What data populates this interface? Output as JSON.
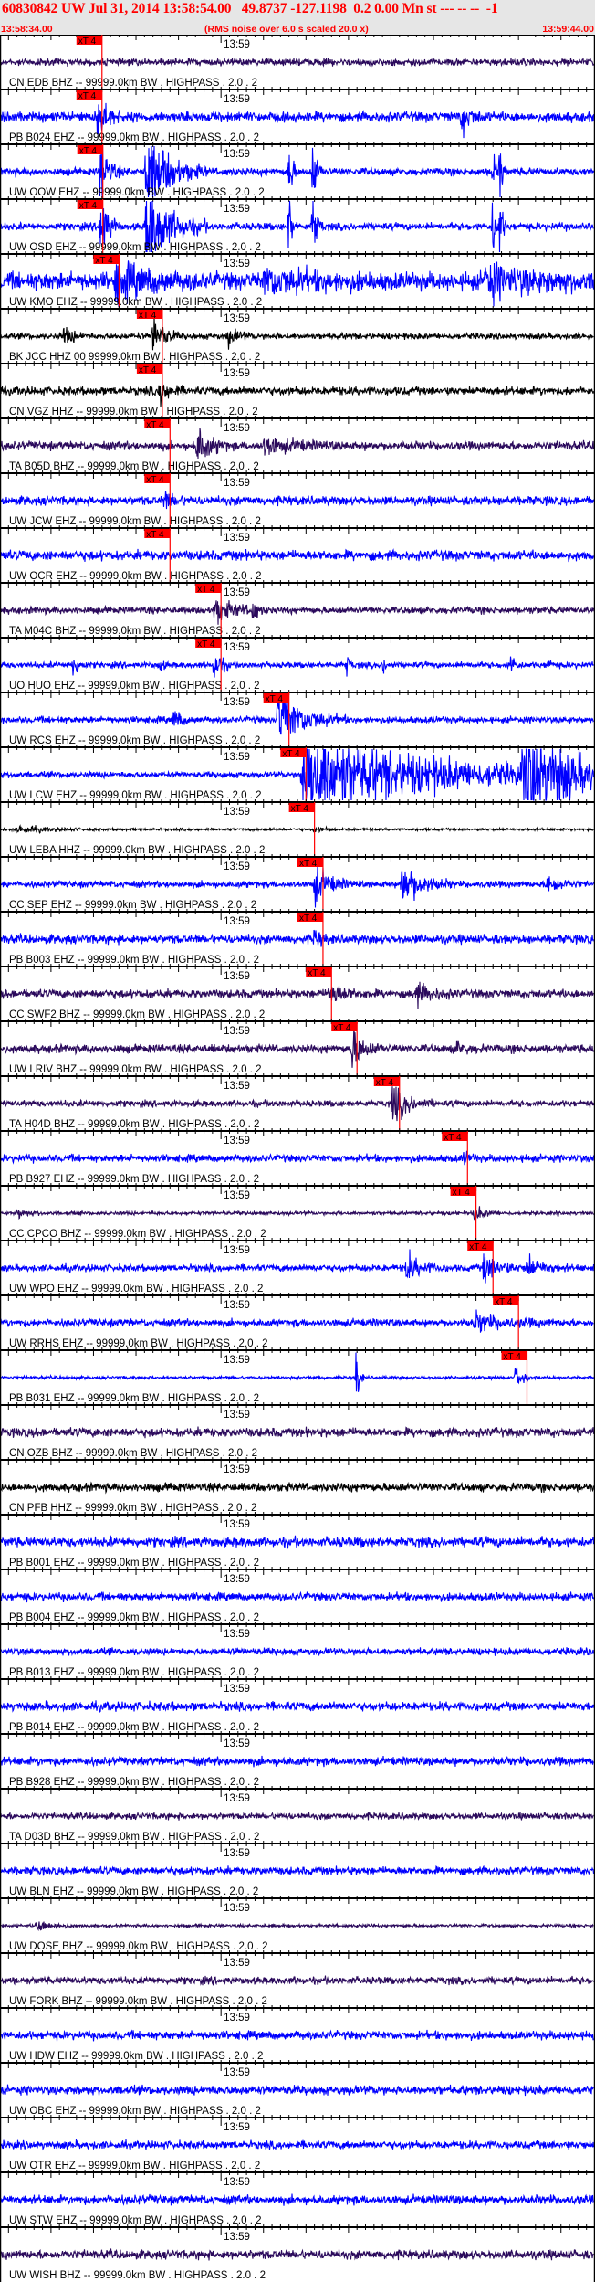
{
  "header": {
    "title": "60830842 UW Jul 31, 2014 13:58:54.00   49.8737 -127.1198  0.2 0.00 Mn st --- -- --  -1",
    "start_time": "13:58:34.00",
    "end_time": "13:59:44.00",
    "note": "(RMS noise over 6.0 s scaled 20.0 x)"
  },
  "time_axis": {
    "minute_label": "13:59",
    "minute_time": "13:59:00",
    "major_tick_s": 5,
    "minor_tick_s": 1
  },
  "pick_label": "xT 4",
  "colors": {
    "pick": "#ff0000",
    "header_text": "#ff0000",
    "header_bg": "#e6e6e6"
  },
  "traces": [
    {
      "label": "CN EDB BHZ -- 99999.0km BW . HIGHPASS . 2.0 . 2",
      "color": "#2b0a5c",
      "pick": "13:58:46.0",
      "noise": 0.14,
      "bursts": []
    },
    {
      "label": "PB B024 EHZ -- 99999.0km BW . HIGHPASS . 2.0 . 2",
      "color": "#0000ff",
      "pick": "13:58:46.0",
      "noise": 0.2,
      "bursts": [
        [
          "13:58:45.4",
          0.9,
          2
        ],
        [
          "13:59:28.3",
          0.5,
          2
        ]
      ]
    },
    {
      "label": "UW OOW EHZ -- 99999.0km BW . HIGHPASS . 2.0 . 2",
      "color": "#0000ff",
      "pick": "13:58:46.1",
      "noise": 0.15,
      "bursts": [
        [
          "13:58:45.8",
          1.6,
          1.5
        ],
        [
          "13:58:51.2",
          1.8,
          4.5
        ],
        [
          "13:59:08.0",
          1.5,
          0.6
        ],
        [
          "13:59:10.8",
          1.5,
          0.8
        ],
        [
          "13:59:32.0",
          1.5,
          0.5
        ],
        [
          "13:59:32.8",
          1.5,
          0.5
        ]
      ]
    },
    {
      "label": "UW OSD EHZ -- 99999.0km BW . HIGHPASS . 2.0 . 2",
      "color": "#0000ff",
      "pick": "13:58:46.1",
      "noise": 0.15,
      "bursts": [
        [
          "13:58:45.8",
          1.6,
          1.5
        ],
        [
          "13:58:51.2",
          1.8,
          4.5
        ],
        [
          "13:59:08.0",
          1.5,
          0.6
        ],
        [
          "13:59:10.8",
          1.5,
          0.8
        ],
        [
          "13:59:32.0",
          1.5,
          0.5
        ],
        [
          "13:59:32.8",
          1.5,
          0.5
        ]
      ]
    },
    {
      "label": "UW KMO EHZ -- 99999.0km BW . HIGHPASS . 2.0 . 2",
      "color": "#0000ff",
      "pick": "13:58:48.0",
      "noise": 0.35,
      "bursts": [
        [
          "13:58:47.5",
          0.7,
          6
        ],
        [
          "13:59:05.1",
          0.4,
          10
        ],
        [
          "13:59:30.9",
          0.5,
          12
        ]
      ]
    },
    {
      "label": "BK JCC HHZ 00 99999.0km BW . HIGHPASS . 2.0 . 2",
      "color": "#000000",
      "pick": "13:58:53.1",
      "noise": 0.12,
      "bursts": [
        [
          "13:58:41.5",
          0.35,
          2
        ],
        [
          "13:58:52.0",
          0.8,
          2
        ],
        [
          "13:59:00.8",
          0.35,
          2
        ]
      ]
    },
    {
      "label": "CN VGZ HHZ -- 99999.0km BW . HIGHPASS . 2.0 . 2",
      "color": "#000000",
      "pick": "13:58:53.1",
      "noise": 0.17,
      "bursts": [
        [
          "13:58:52.8",
          0.45,
          2
        ]
      ]
    },
    {
      "label": "TA B05D BHZ -- 99999.0km BW . HIGHPASS . 2.0 . 2",
      "color": "#2b0a5c",
      "pick": "13:58:54.0",
      "noise": 0.17,
      "bursts": [
        [
          "13:58:57.2",
          0.75,
          2.5
        ],
        [
          "13:59:05.1",
          0.3,
          6
        ]
      ]
    },
    {
      "label": "UW JCW EHZ -- 99999.0km BW . HIGHPASS . 2.0 . 2",
      "color": "#0000ff",
      "pick": "13:58:54.0",
      "noise": 0.18,
      "bursts": [
        [
          "13:58:53.3",
          0.3,
          2
        ]
      ]
    },
    {
      "label": "UW OCR EHZ -- 99999.0km BW . HIGHPASS . 2.0 . 2",
      "color": "#0000ff",
      "pick": "13:58:54.0",
      "noise": 0.2,
      "bursts": []
    },
    {
      "label": "TA M04C BHZ -- 99999.0km BW . HIGHPASS . 2.0 . 2",
      "color": "#2b0a5c",
      "pick": "13:59:00.0",
      "noise": 0.14,
      "bursts": [
        [
          "13:58:59.2",
          0.45,
          4
        ],
        [
          "13:59:03.7",
          0.4,
          1
        ]
      ]
    },
    {
      "label": "UO HUO EHZ -- 99999.0km BW . HIGHPASS . 2.0 . 2",
      "color": "#0000ff",
      "pick": "13:59:00.0",
      "noise": 0.12,
      "bursts": [
        [
          "13:58:42.6",
          0.5,
          1
        ],
        [
          "13:58:52.8",
          0.35,
          0.5
        ],
        [
          "13:58:59.2",
          0.6,
          1.5
        ],
        [
          "13:59:14.8",
          0.5,
          0.5
        ],
        [
          "13:59:19.1",
          0.4,
          0.5
        ],
        [
          "13:59:34.1",
          0.5,
          0.7
        ],
        [
          "13:59:38.4",
          0.4,
          0.5
        ]
      ]
    },
    {
      "label": "UW RCS EHZ -- 99999.0km BW . HIGHPASS . 2.0 . 2",
      "color": "#0000ff",
      "pick": "13:59:08.0",
      "noise": 0.13,
      "bursts": [
        [
          "13:58:54.4",
          0.4,
          1.5
        ],
        [
          "13:59:06.7",
          1.2,
          5
        ]
      ]
    },
    {
      "label": "UW LCW EHZ -- 99999.0km BW . HIGHPASS . 2.0 . 2",
      "color": "#0000ff",
      "pick": "13:59:10.0",
      "noise": 0.12,
      "bursts": [
        [
          "13:59:09.5",
          1.8,
          26
        ],
        [
          "13:59:35.5",
          1.8,
          10
        ]
      ]
    },
    {
      "label": "UW LEBA HHZ -- 99999.0km BW . HIGHPASS . 2.0 . 2",
      "color": "#000000",
      "pick": "13:59:11.0",
      "noise": 0.05,
      "bursts": [
        [
          "13:58:36.1",
          0.15,
          6
        ],
        [
          "13:59:11.0",
          0.12,
          2
        ]
      ]
    },
    {
      "label": "CC SEP EHZ -- 99999.0km BW . HIGHPASS . 2.0 . 2",
      "color": "#0000ff",
      "pick": "13:59:12.0",
      "noise": 0.13,
      "bursts": [
        [
          "13:59:11.0",
          0.7,
          3
        ],
        [
          "13:59:21.2",
          0.9,
          4
        ],
        [
          "13:59:38.4",
          0.4,
          2.5
        ]
      ]
    },
    {
      "label": "PB B003 EHZ -- 99999.0km BW . HIGHPASS . 2.0 . 2",
      "color": "#0000ff",
      "pick": "13:59:12.0",
      "noise": 0.18,
      "bursts": [
        [
          "13:59:11.0",
          0.3,
          1.5
        ]
      ]
    },
    {
      "label": "CC SWF2 BHZ -- 99999.0km BW . HIGHPASS . 2.0 . 2",
      "color": "#2b0a5c",
      "pick": "13:59:13.0",
      "noise": 0.17,
      "bursts": [
        [
          "13:59:12.7",
          0.4,
          3
        ],
        [
          "13:59:22.9",
          0.4,
          3
        ]
      ]
    },
    {
      "label": "UW LRIV BHZ -- 99999.0km BW . HIGHPASS . 2.0 . 2",
      "color": "#2b0a5c",
      "pick": "13:59:16.0",
      "noise": 0.17,
      "bursts": [
        [
          "13:59:15.3",
          0.8,
          2.5
        ],
        [
          "13:59:27.7",
          0.25,
          2
        ]
      ]
    },
    {
      "label": "TA H04D BHZ -- 99999.0km BW . HIGHPASS . 2.0 . 2",
      "color": "#2b0a5c",
      "pick": "13:59:21.0",
      "noise": 0.13,
      "bursts": [
        [
          "13:59:20.2",
          0.75,
          3
        ]
      ]
    },
    {
      "label": "PB B927 EHZ -- 99999.0km BW . HIGHPASS . 2.0 . 2",
      "color": "#0000ff",
      "pick": "13:59:29.0",
      "noise": 0.15,
      "bursts": [
        [
          "13:59:28.5",
          0.25,
          1
        ]
      ]
    },
    {
      "label": "CC CPCO BHZ -- 99999.0km BW . HIGHPASS . 2.0 . 2",
      "color": "#2b0a5c",
      "pick": "13:59:30.0",
      "noise": 0.07,
      "bursts": [
        [
          "13:58:36.1",
          0.2,
          2
        ],
        [
          "13:59:29.8",
          0.3,
          2
        ]
      ]
    },
    {
      "label": "UW WPO EHZ -- 99999.0km BW . HIGHPASS . 2.0 . 2",
      "color": "#0000ff",
      "pick": "13:59:32.0",
      "noise": 0.14,
      "bursts": [
        [
          "13:59:21.8",
          0.5,
          3
        ],
        [
          "13:59:30.9",
          0.55,
          3
        ],
        [
          "13:59:36.0",
          0.4,
          3
        ]
      ]
    },
    {
      "label": "UW RRHS EHZ -- 99999.0km BW . HIGHPASS . 2.0 . 2",
      "color": "#0000ff",
      "pick": "13:59:35.0",
      "noise": 0.15,
      "bursts": [
        [
          "13:59:29.8",
          0.3,
          6
        ]
      ]
    },
    {
      "label": "PB B031 EHZ -- 99999.0km BW . HIGHPASS . 2.0 . 2",
      "color": "#0000ff",
      "pick": "13:59:36.0",
      "noise": 0.06,
      "bursts": [
        [
          "13:59:15.9",
          1.2,
          0.6
        ],
        [
          "13:59:34.7",
          0.8,
          1
        ]
      ]
    },
    {
      "label": "CN OZB BHZ -- 99999.0km BW . HIGHPASS . 2.0 . 2",
      "color": "#2b0a5c",
      "pick": null,
      "noise": 0.18,
      "bursts": []
    },
    {
      "label": "CN PFB HHZ -- 99999.0km BW . HIGHPASS . 2.0 . 2",
      "color": "#000000",
      "pick": null,
      "noise": 0.17,
      "bursts": []
    },
    {
      "label": "PB B001 EHZ -- 99999.0km BW . HIGHPASS . 2.0 . 2",
      "color": "#0000ff",
      "pick": null,
      "noise": 0.2,
      "bursts": []
    },
    {
      "label": "PB B004 EHZ -- 99999.0km BW . HIGHPASS . 2.0 . 2",
      "color": "#0000ff",
      "pick": null,
      "noise": 0.16,
      "bursts": []
    },
    {
      "label": "PB B013 EHZ -- 99999.0km BW . HIGHPASS . 2.0 . 2",
      "color": "#0000ff",
      "pick": null,
      "noise": 0.14,
      "bursts": []
    },
    {
      "label": "PB B014 EHZ -- 99999.0km BW . HIGHPASS . 2.0 . 2",
      "color": "#0000ff",
      "pick": null,
      "noise": 0.18,
      "bursts": []
    },
    {
      "label": "PB B928 EHZ -- 99999.0km BW . HIGHPASS . 2.0 . 2",
      "color": "#0000ff",
      "pick": null,
      "noise": 0.17,
      "bursts": []
    },
    {
      "label": "TA D03D BHZ -- 99999.0km BW . HIGHPASS . 2.0 . 2",
      "color": "#2b0a5c",
      "pick": null,
      "noise": 0.13,
      "bursts": []
    },
    {
      "label": "UW BLN EHZ -- 99999.0km BW . HIGHPASS . 2.0 . 2",
      "color": "#0000ff",
      "pick": null,
      "noise": 0.16,
      "bursts": []
    },
    {
      "label": "UW DOSE BHZ -- 99999.0km BW . HIGHPASS . 2.0 . 2",
      "color": "#2b0a5c",
      "pick": null,
      "noise": 0.06,
      "bursts": [
        [
          "13:58:38.3",
          0.25,
          3
        ]
      ]
    },
    {
      "label": "UW FORK BHZ -- 99999.0km BW . HIGHPASS . 2.0 . 2",
      "color": "#2b0a5c",
      "pick": null,
      "noise": 0.15,
      "bursts": []
    },
    {
      "label": "UW HDW EHZ -- 99999.0km BW . HIGHPASS . 2.0 . 2",
      "color": "#0000ff",
      "pick": null,
      "noise": 0.17,
      "bursts": []
    },
    {
      "label": "UW OBC EHZ -- 99999.0km BW . HIGHPASS . 2.0 . 2",
      "color": "#0000ff",
      "pick": null,
      "noise": 0.18,
      "bursts": []
    },
    {
      "label": "UW OTR EHZ -- 99999.0km BW . HIGHPASS . 2.0 . 2",
      "color": "#0000ff",
      "pick": null,
      "noise": 0.16,
      "bursts": []
    },
    {
      "label": "UW STW EHZ -- 99999.0km BW . HIGHPASS . 2.0 . 2",
      "color": "#0000ff",
      "pick": null,
      "noise": 0.18,
      "bursts": []
    },
    {
      "label": "UW WISH BHZ -- 99999.0km BW . HIGHPASS . 2.0 . 2",
      "color": "#2b0a5c",
      "pick": null,
      "noise": 0.18,
      "bursts": []
    }
  ]
}
